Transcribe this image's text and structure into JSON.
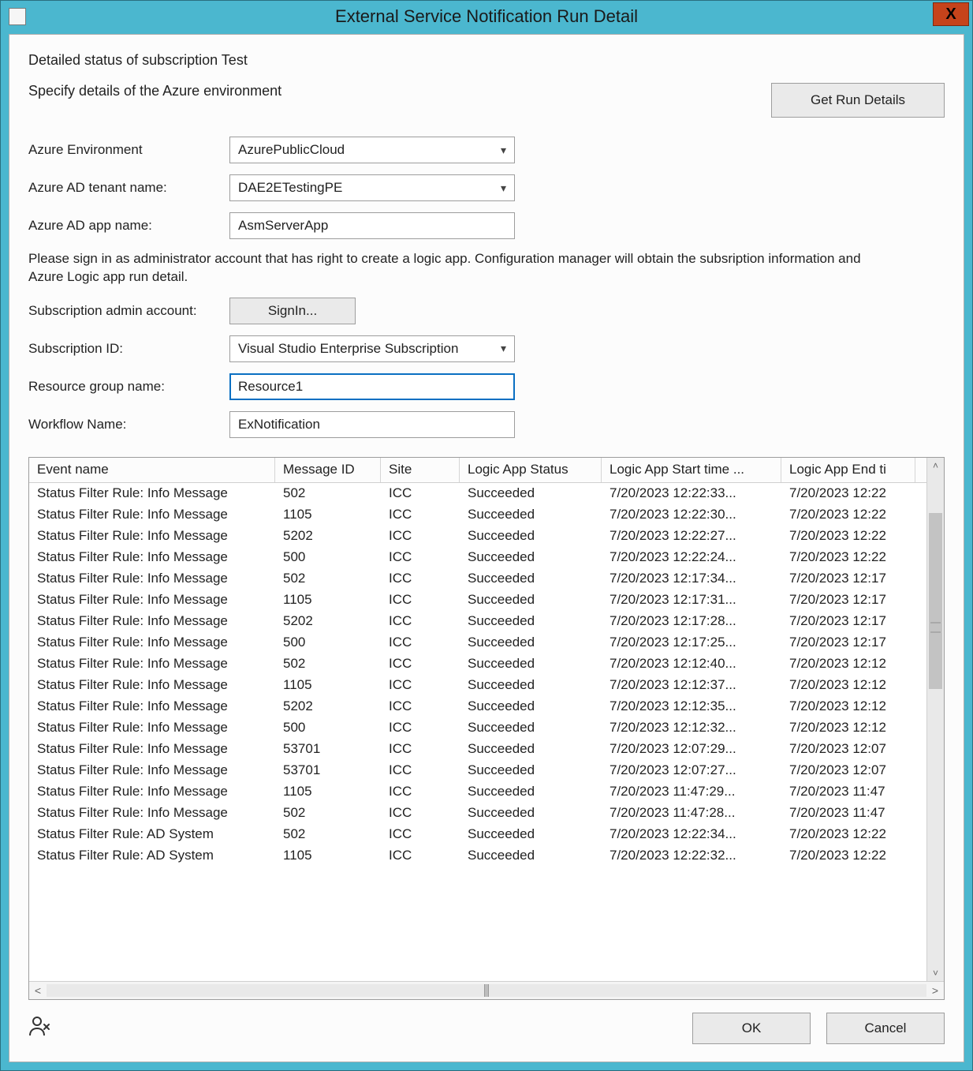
{
  "window": {
    "title": "External Service Notification Run Detail",
    "close_symbol": "X"
  },
  "heading": "Detailed status of subscription Test",
  "specify_label": "Specify details of the Azure environment",
  "get_run_details_label": "Get Run Details",
  "labels": {
    "azure_env": "Azure Environment",
    "ad_tenant": "Azure AD tenant name:",
    "ad_app": "Azure AD app name:",
    "sub_admin": "Subscription admin account:",
    "sub_id": "Subscription ID:",
    "res_group": "Resource group name:",
    "workflow": "Workflow Name:"
  },
  "values": {
    "azure_env": "AzurePublicCloud",
    "ad_tenant": "DAE2ETestingPE",
    "ad_app": "AsmServerApp",
    "signin": "SignIn...",
    "sub_id": "Visual Studio Enterprise Subscription",
    "res_group": "Resource1",
    "workflow": "ExNotification"
  },
  "info_paragraph": "Please sign in as administrator account that has right to create a logic app. Configuration manager will obtain the subsription information and Azure Logic app run detail.",
  "grid": {
    "columns": [
      "Event name",
      "Message ID",
      "Site",
      "Logic App Status",
      "Logic App Start time ...",
      "Logic App End ti"
    ],
    "rows": [
      {
        "event": "Status Filter Rule: Info Message",
        "msg": "502",
        "site": "ICC",
        "status": "Succeeded",
        "start": "7/20/2023 12:22:33...",
        "end": "7/20/2023 12:22"
      },
      {
        "event": "Status Filter Rule: Info Message",
        "msg": "1105",
        "site": "ICC",
        "status": "Succeeded",
        "start": "7/20/2023 12:22:30...",
        "end": "7/20/2023 12:22"
      },
      {
        "event": "Status Filter Rule: Info Message",
        "msg": "5202",
        "site": "ICC",
        "status": "Succeeded",
        "start": "7/20/2023 12:22:27...",
        "end": "7/20/2023 12:22"
      },
      {
        "event": "Status Filter Rule: Info Message",
        "msg": "500",
        "site": "ICC",
        "status": "Succeeded",
        "start": "7/20/2023 12:22:24...",
        "end": "7/20/2023 12:22"
      },
      {
        "event": "Status Filter Rule: Info Message",
        "msg": "502",
        "site": "ICC",
        "status": "Succeeded",
        "start": "7/20/2023 12:17:34...",
        "end": "7/20/2023 12:17"
      },
      {
        "event": "Status Filter Rule: Info Message",
        "msg": "1105",
        "site": "ICC",
        "status": "Succeeded",
        "start": "7/20/2023 12:17:31...",
        "end": "7/20/2023 12:17"
      },
      {
        "event": "Status Filter Rule: Info Message",
        "msg": "5202",
        "site": "ICC",
        "status": "Succeeded",
        "start": "7/20/2023 12:17:28...",
        "end": "7/20/2023 12:17"
      },
      {
        "event": "Status Filter Rule: Info Message",
        "msg": "500",
        "site": "ICC",
        "status": "Succeeded",
        "start": "7/20/2023 12:17:25...",
        "end": "7/20/2023 12:17"
      },
      {
        "event": "Status Filter Rule: Info Message",
        "msg": "502",
        "site": "ICC",
        "status": "Succeeded",
        "start": "7/20/2023 12:12:40...",
        "end": "7/20/2023 12:12"
      },
      {
        "event": "Status Filter Rule: Info Message",
        "msg": "1105",
        "site": "ICC",
        "status": "Succeeded",
        "start": "7/20/2023 12:12:37...",
        "end": "7/20/2023 12:12"
      },
      {
        "event": "Status Filter Rule: Info Message",
        "msg": "5202",
        "site": "ICC",
        "status": "Succeeded",
        "start": "7/20/2023 12:12:35...",
        "end": "7/20/2023 12:12"
      },
      {
        "event": "Status Filter Rule: Info Message",
        "msg": "500",
        "site": "ICC",
        "status": "Succeeded",
        "start": "7/20/2023 12:12:32...",
        "end": "7/20/2023 12:12"
      },
      {
        "event": "Status Filter Rule: Info Message",
        "msg": "53701",
        "site": "ICC",
        "status": "Succeeded",
        "start": "7/20/2023 12:07:29...",
        "end": "7/20/2023 12:07"
      },
      {
        "event": "Status Filter Rule: Info Message",
        "msg": "53701",
        "site": "ICC",
        "status": "Succeeded",
        "start": "7/20/2023 12:07:27...",
        "end": "7/20/2023 12:07"
      },
      {
        "event": "Status Filter Rule: Info Message",
        "msg": "1105",
        "site": "ICC",
        "status": "Succeeded",
        "start": "7/20/2023 11:47:29...",
        "end": "7/20/2023 11:47"
      },
      {
        "event": "Status Filter Rule: Info Message",
        "msg": "502",
        "site": "ICC",
        "status": "Succeeded",
        "start": "7/20/2023 11:47:28...",
        "end": "7/20/2023 11:47"
      },
      {
        "event": "Status Filter Rule: AD System",
        "msg": "502",
        "site": "ICC",
        "status": "Succeeded",
        "start": "7/20/2023 12:22:34...",
        "end": "7/20/2023 12:22"
      },
      {
        "event": "Status Filter Rule: AD System",
        "msg": "1105",
        "site": "ICC",
        "status": "Succeeded",
        "start": "7/20/2023 12:22:32...",
        "end": "7/20/2023 12:22"
      }
    ]
  },
  "footer": {
    "ok": "OK",
    "cancel": "Cancel"
  }
}
